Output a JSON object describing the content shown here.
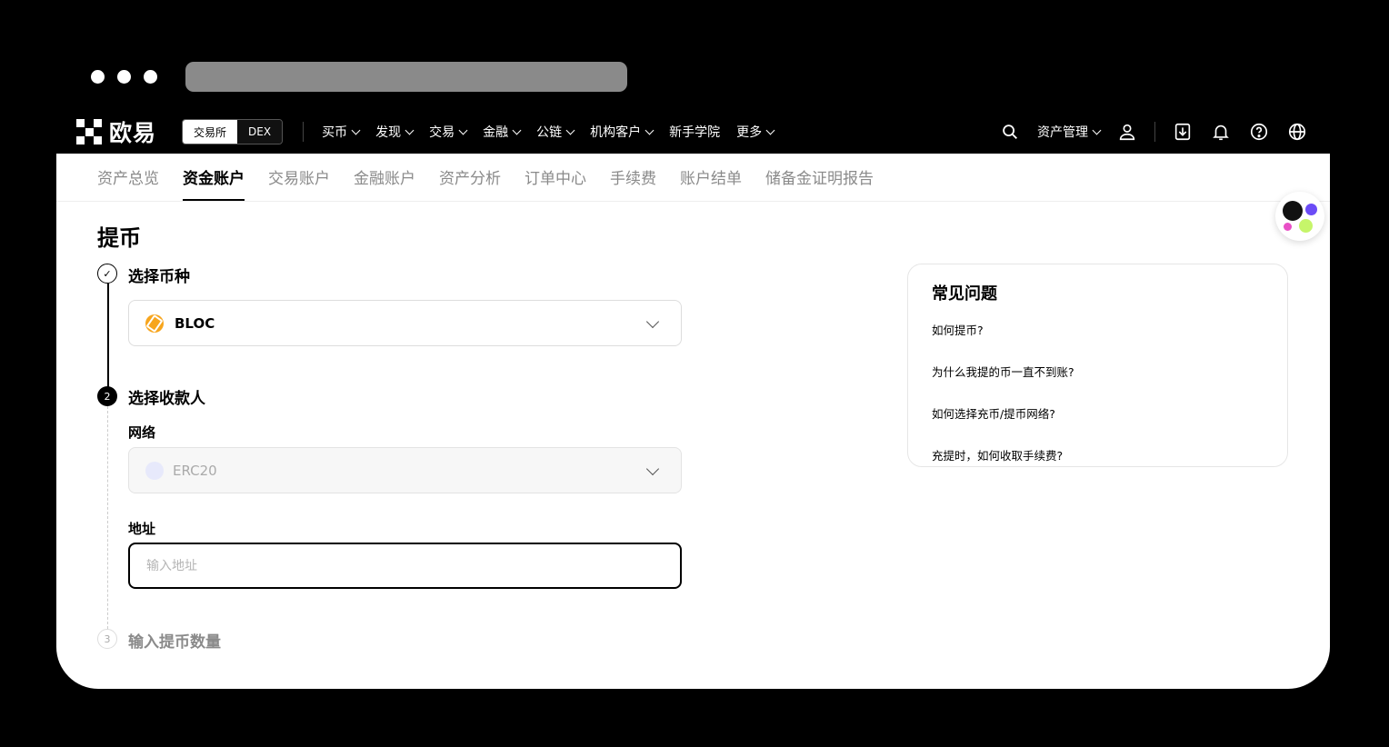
{
  "browser": {
    "dots": 3
  },
  "topnav": {
    "logo_text": "欧易",
    "mode_active": "交易所",
    "mode_inactive": "DEX",
    "items": [
      {
        "label": "买币",
        "dropdown": true
      },
      {
        "label": "发现",
        "dropdown": true
      },
      {
        "label": "交易",
        "dropdown": true
      },
      {
        "label": "金融",
        "dropdown": true
      },
      {
        "label": "公链",
        "dropdown": true
      },
      {
        "label": "机构客户",
        "dropdown": true
      },
      {
        "label": "新手学院",
        "dropdown": false
      },
      {
        "label": "更多",
        "dropdown": true
      }
    ],
    "asset_menu": "资产管理",
    "icons": [
      "search-icon",
      "user-icon",
      "download-icon",
      "bell-icon",
      "help-icon",
      "globe-icon"
    ]
  },
  "subnav": {
    "tabs": [
      {
        "label": "资产总览",
        "active": false
      },
      {
        "label": "资金账户",
        "active": true
      },
      {
        "label": "交易账户",
        "active": false
      },
      {
        "label": "金融账户",
        "active": false
      },
      {
        "label": "资产分析",
        "active": false
      },
      {
        "label": "订单中心",
        "active": false
      },
      {
        "label": "手续费",
        "active": false
      },
      {
        "label": "账户结单",
        "active": false
      },
      {
        "label": "储备金证明报告",
        "active": false
      }
    ]
  },
  "page": {
    "title": "提币",
    "steps": [
      {
        "number": "✓",
        "label": "选择币种",
        "state": "done"
      },
      {
        "number": "2",
        "label": "选择收款人",
        "state": "active"
      },
      {
        "number": "3",
        "label": "输入提币数量",
        "state": "pending"
      }
    ],
    "coin": {
      "value": "BLOC",
      "icon": "bloc-coin-icon"
    },
    "network": {
      "label": "网络",
      "value": "ERC20",
      "icon": "erc20-network-icon"
    },
    "address": {
      "label": "地址",
      "placeholder": "输入地址",
      "value": ""
    }
  },
  "faq": {
    "title": "常见问题",
    "items": [
      "如何提币?",
      "为什么我提的币一直不到账?",
      "如何选择充币/提币网络?",
      "充提时，如何收取手续费?"
    ]
  },
  "colors": {
    "accent": "#000000",
    "coin": "#f7a51d",
    "badge_dots": [
      "#111111",
      "#6b4cf6",
      "#e84fc6",
      "#c6f56a"
    ]
  }
}
